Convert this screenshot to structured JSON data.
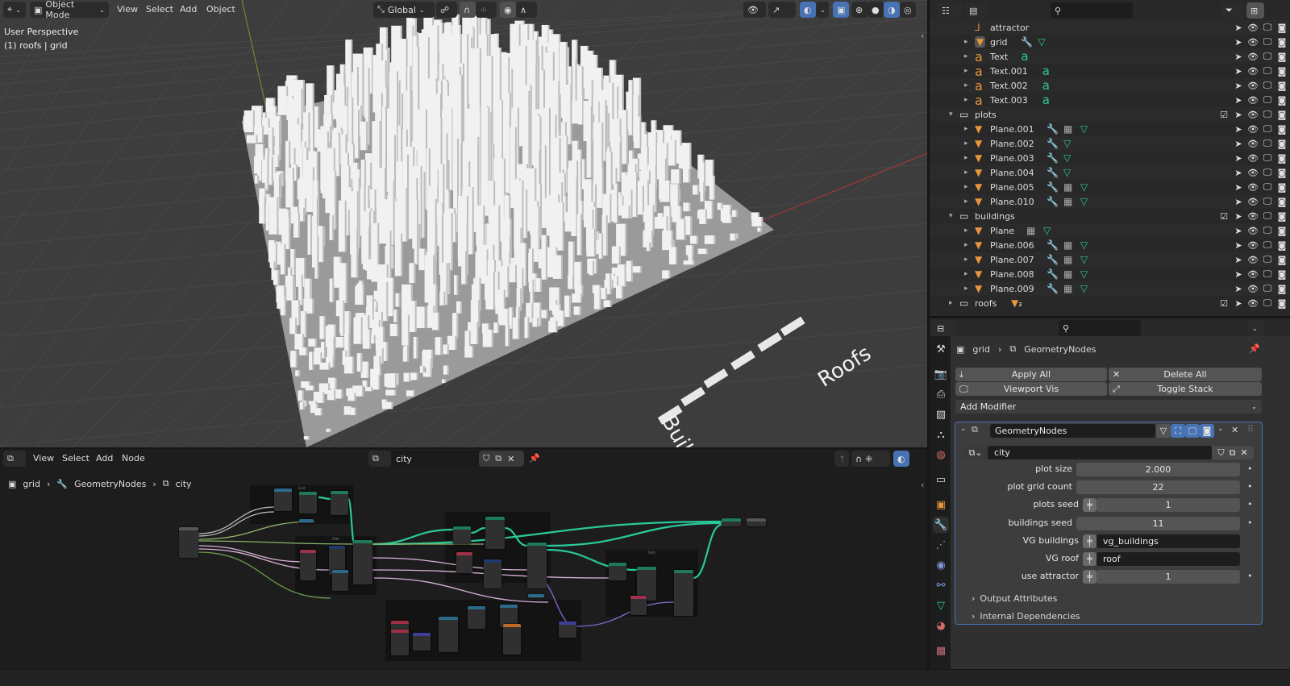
{
  "viewport": {
    "header": {
      "mode": "Object Mode",
      "menus": [
        "View",
        "Select",
        "Add",
        "Object"
      ],
      "orientation": "Global"
    },
    "overlay_text": {
      "view": "User Perspective",
      "context": "(1) roofs | grid"
    },
    "scene_text": {
      "roofs": "Roofs",
      "buildings": "Buildings"
    }
  },
  "node_editor": {
    "menus": [
      "View",
      "Select",
      "Add",
      "Node"
    ],
    "node_group": "city",
    "breadcrumb": [
      "grid",
      "GeometryNodes",
      "city"
    ],
    "frames": [
      "Grid",
      "Path",
      "Path",
      "Path"
    ]
  },
  "outliner": {
    "rows": [
      {
        "name": "attractor",
        "type": "empty",
        "depth": 2,
        "expand": false,
        "extras": []
      },
      {
        "name": "grid",
        "type": "mesh",
        "depth": 2,
        "expand": true,
        "active": true,
        "extras": [
          "wrench",
          "mesh"
        ]
      },
      {
        "name": "Text",
        "type": "text",
        "depth": 2,
        "expand": true,
        "extras": [
          "text"
        ]
      },
      {
        "name": "Text.001",
        "type": "text",
        "depth": 2,
        "expand": true,
        "extras": [
          "text"
        ]
      },
      {
        "name": "Text.002",
        "type": "text",
        "depth": 2,
        "expand": true,
        "extras": [
          "text"
        ]
      },
      {
        "name": "Text.003",
        "type": "text",
        "depth": 2,
        "expand": true,
        "extras": [
          "text"
        ]
      },
      {
        "name": "plots",
        "type": "collection",
        "depth": 1,
        "expand": "open",
        "extras": []
      },
      {
        "name": "Plane.001",
        "type": "mesh",
        "depth": 2,
        "expand": true,
        "extras": [
          "wrench",
          "vgroups",
          "mesh"
        ]
      },
      {
        "name": "Plane.002",
        "type": "mesh",
        "depth": 2,
        "expand": true,
        "extras": [
          "wrench",
          "mesh"
        ]
      },
      {
        "name": "Plane.003",
        "type": "mesh",
        "depth": 2,
        "expand": true,
        "extras": [
          "wrench",
          "mesh"
        ]
      },
      {
        "name": "Plane.004",
        "type": "mesh",
        "depth": 2,
        "expand": true,
        "extras": [
          "wrench",
          "mesh"
        ]
      },
      {
        "name": "Plane.005",
        "type": "mesh",
        "depth": 2,
        "expand": true,
        "extras": [
          "wrench",
          "vgroups",
          "mesh"
        ]
      },
      {
        "name": "Plane.010",
        "type": "mesh",
        "depth": 2,
        "expand": true,
        "extras": [
          "wrench",
          "vgroups",
          "mesh"
        ]
      },
      {
        "name": "buildings",
        "type": "collection",
        "depth": 1,
        "expand": "open",
        "extras": []
      },
      {
        "name": "Plane",
        "type": "mesh",
        "depth": 2,
        "expand": true,
        "extras": [
          "vgroups",
          "mesh"
        ]
      },
      {
        "name": "Plane.006",
        "type": "mesh",
        "depth": 2,
        "expand": true,
        "extras": [
          "wrench",
          "vgroups",
          "mesh"
        ]
      },
      {
        "name": "Plane.007",
        "type": "mesh",
        "depth": 2,
        "expand": true,
        "extras": [
          "wrench",
          "vgroups",
          "mesh"
        ]
      },
      {
        "name": "Plane.008",
        "type": "mesh",
        "depth": 2,
        "expand": true,
        "extras": [
          "wrench",
          "vgroups",
          "mesh"
        ]
      },
      {
        "name": "Plane.009",
        "type": "mesh",
        "depth": 2,
        "expand": true,
        "extras": [
          "wrench",
          "vgroups",
          "mesh"
        ]
      },
      {
        "name": "roofs",
        "type": "collection",
        "depth": 1,
        "expand": "closed",
        "extras": [
          "mesh3"
        ],
        "badge": "3"
      }
    ]
  },
  "properties": {
    "breadcrumb": {
      "object": "grid",
      "modifier": "GeometryNodes"
    },
    "apply_all": "Apply All",
    "delete_all": "Delete All",
    "viewport_vis": "Viewport Vis",
    "toggle_stack": "Toggle Stack",
    "add_modifier": "Add Modifier",
    "modifier": {
      "name": "GeometryNodes",
      "node_group": "city",
      "inputs": [
        {
          "label": "plot size",
          "value": "2.000",
          "kind": "num"
        },
        {
          "label": "plot grid count",
          "value": "22",
          "kind": "num"
        },
        {
          "label": "plots seed",
          "value": "1",
          "kind": "attr"
        },
        {
          "label": "buildings seed",
          "value": "11",
          "kind": "num"
        },
        {
          "label": "VG buildings",
          "value": "vg_buildings",
          "kind": "str"
        },
        {
          "label": "VG roof",
          "value": "roof",
          "kind": "str"
        },
        {
          "label": "use attractor",
          "value": "1",
          "kind": "attr"
        }
      ],
      "panels": [
        "Output Attributes",
        "Internal Dependencies"
      ]
    }
  },
  "colors": {
    "accent": "#4772b3",
    "object_orange": "#e8953d",
    "data_green": "#2bc99a",
    "modifier_blue": "#7b9be0"
  }
}
